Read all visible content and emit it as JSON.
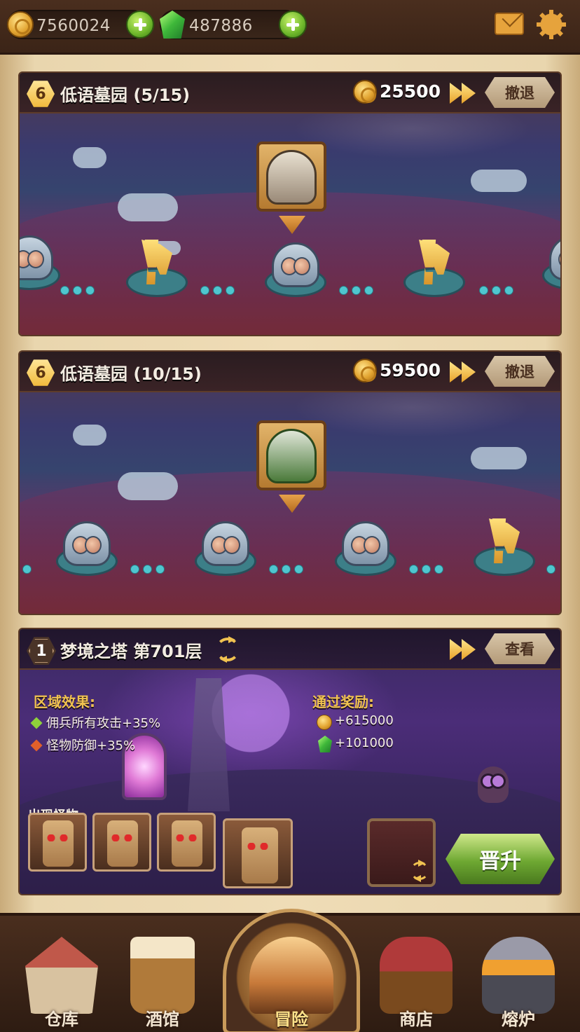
{
  "resources": {
    "coins": "7560024",
    "gems": "487886",
    "coin_icon": "coin-icon",
    "gem_icon": "green-gem-icon"
  },
  "stages": [
    {
      "level": "6",
      "title": "低语墓园 (5/15)",
      "reward": "25500",
      "button": "撤退",
      "boss": "armored-knight-boss"
    },
    {
      "level": "6",
      "title": "低语墓园 (10/15)",
      "reward": "59500",
      "button": "撤退",
      "boss": "hooded-rogue-boss"
    }
  ],
  "tower": {
    "level": "1",
    "title": "梦境之塔 第701层",
    "button": "查看",
    "effects_label": "区域效果:",
    "effects": [
      {
        "text": "佣兵所有攻击+35%",
        "color": "#8fd23a"
      },
      {
        "text": "怪物防御+35%",
        "color": "#e0602a"
      }
    ],
    "rewards_label": "通过奖励:",
    "rewards": {
      "coins": "+615000",
      "gems": "+101000"
    },
    "monsters_label": "出现怪物:",
    "promote_button": "晋升"
  },
  "nav": [
    {
      "label": "仓库",
      "icon": "warehouse-icon"
    },
    {
      "label": "酒馆",
      "icon": "tavern-icon"
    },
    {
      "label": "冒险",
      "icon": "adventure-icon",
      "active": true
    },
    {
      "label": "商店",
      "icon": "shop-icon"
    },
    {
      "label": "熔炉",
      "icon": "forge-icon"
    }
  ],
  "colors": {
    "gold": "#f0c250",
    "teal_path": "#4fc6cf",
    "green_button": "#6ea832"
  }
}
